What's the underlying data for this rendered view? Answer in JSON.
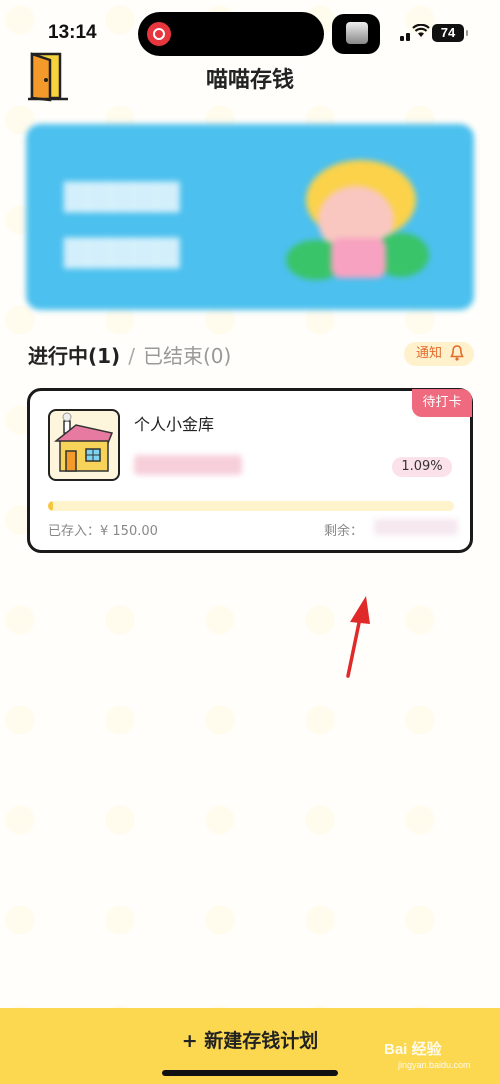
{
  "status_bar": {
    "time": "13:14",
    "battery": "74"
  },
  "header": {
    "title": "喵喵存钱",
    "left_icon": "door-icon"
  },
  "tabs": {
    "active_label": "进行中(1)",
    "separator": "/",
    "inactive_label": "已结束(0)",
    "notify_label": "通知"
  },
  "plan_card": {
    "stamp_label": "待打卡",
    "name": "个人小金库",
    "percent": "1.09%",
    "progress_fraction": 0.0109,
    "saved_text": "已存入：¥ 150.00",
    "remain_label": "剩余："
  },
  "bottom": {
    "create_label": "+ 新建存钱计划",
    "watermark": "Bai 经验",
    "watermark_url": "jingyan.baidu.com"
  },
  "colors": {
    "accent_yellow": "#fbd84f",
    "stamp_pink": "#ef6a7e",
    "banner_blue": "#4cc0ee",
    "notify_orange": "#e36b2c"
  }
}
